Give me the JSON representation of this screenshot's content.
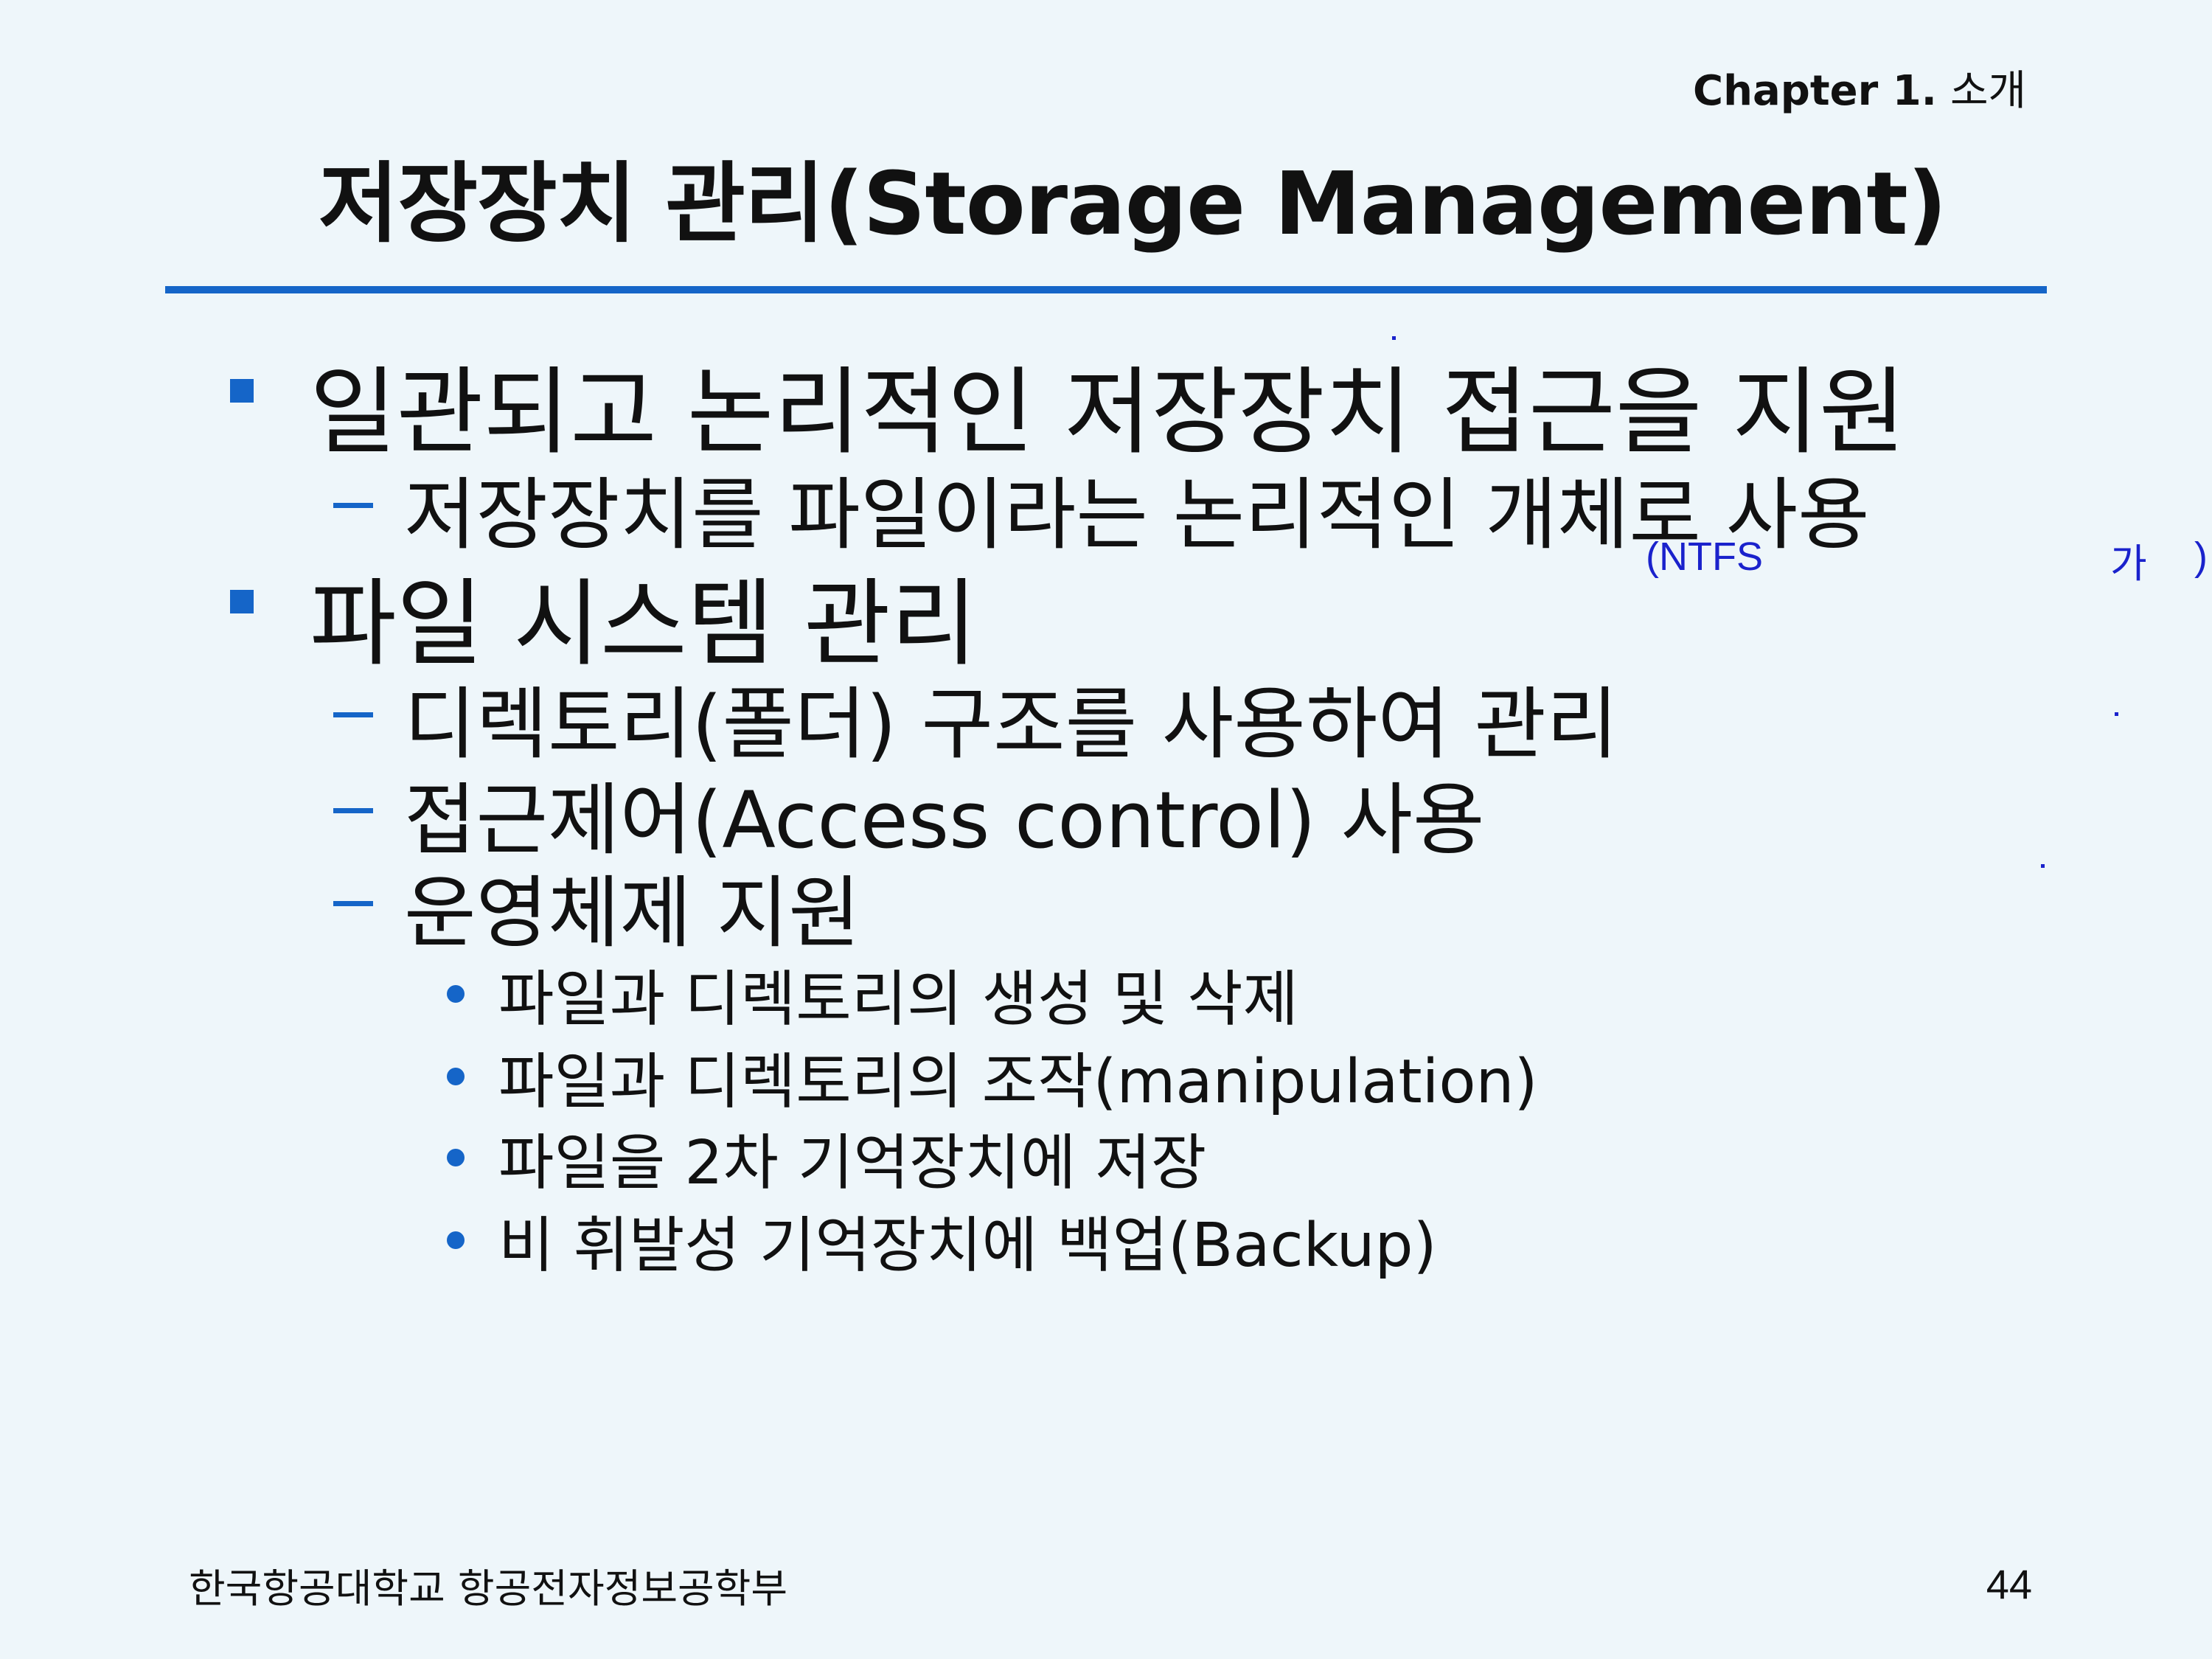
{
  "header": {
    "chapter_label": "Chapter 1.",
    "chapter_name": "소개"
  },
  "title": "저장장치 관리(Storage Management)",
  "body": {
    "bullet1": "일관되고 논리적인 저장장치 접근을 지원",
    "bullet1_sub1": "저장장치를 파일이라는 논리적인 개체로 사용",
    "bullet2": "파일 시스템 관리",
    "bullet2_sub1": "디렉토리(폴더) 구조를 사용하여 관리",
    "bullet2_sub2": "접근제어(Access control) 사용",
    "bullet2_sub3": "운영체제 지원",
    "bullet2_sub3_items": [
      "파일과 디렉토리의 생성 및 삭제",
      "파일과 디렉토리의 조작(manipulation)",
      "파일을 2차 기억장치에 저장",
      "비 휘발성 기억장치에 백업(Backup)"
    ]
  },
  "annotation": {
    "left": "(NTFS",
    "mid": "가",
    "right": ")"
  },
  "footer": {
    "institution": "한국항공대학교 항공전자정보공학부",
    "page_number": "44"
  },
  "colors": {
    "background": "#eef6fa",
    "accent": "#1565c8",
    "annotation": "#1a22cc"
  }
}
